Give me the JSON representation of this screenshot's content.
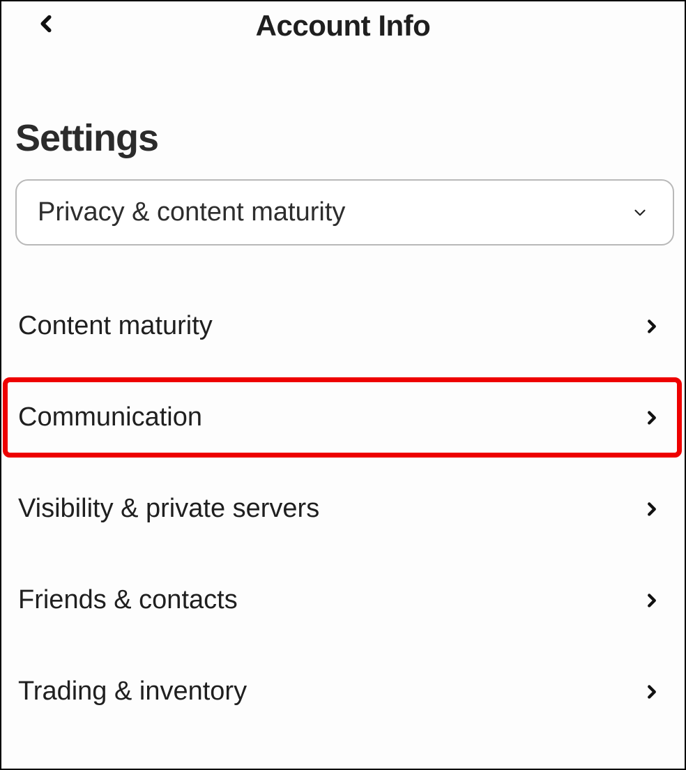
{
  "header": {
    "title": "Account Info"
  },
  "section": {
    "title": "Settings"
  },
  "dropdown": {
    "selected": "Privacy & content maturity"
  },
  "items": [
    {
      "label": "Content maturity",
      "highlighted": false
    },
    {
      "label": "Communication",
      "highlighted": true
    },
    {
      "label": "Visibility & private servers",
      "highlighted": false
    },
    {
      "label": "Friends & contacts",
      "highlighted": false
    },
    {
      "label": "Trading & inventory",
      "highlighted": false
    }
  ],
  "colors": {
    "highlight": "#ee0000"
  }
}
